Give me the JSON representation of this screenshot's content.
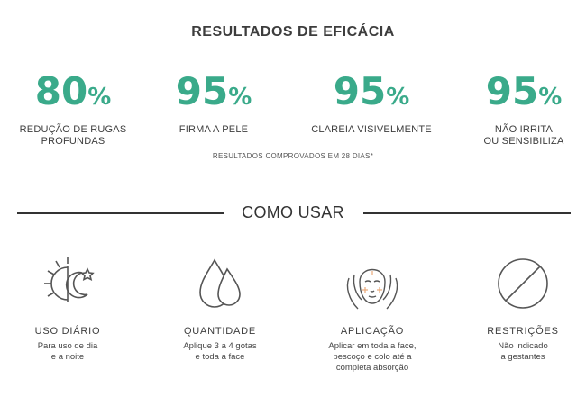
{
  "results": {
    "title": "RESULTADOS DE EFICÁCIA",
    "stats": [
      {
        "value": "80",
        "unit": "%",
        "desc1": "REDUÇÃO DE RUGAS",
        "desc2": "PROFUNDAS"
      },
      {
        "value": "95",
        "unit": "%",
        "desc1": "FIRMA A PELE",
        "desc2": ""
      },
      {
        "value": "95",
        "unit": "%",
        "desc1": "CLAREIA VISIVELMENTE",
        "desc2": ""
      },
      {
        "value": "95",
        "unit": "%",
        "desc1": "NÃO IRRITA",
        "desc2": "OU SENSIBILIZA"
      }
    ],
    "note": "RESULTADOS COMPROVADOS EM 28 DIAS*"
  },
  "usage": {
    "title": "COMO USAR",
    "items": [
      {
        "icon": "sun-moon-icon",
        "title": "USO DIÁRIO",
        "line1": "Para uso de dia",
        "line2": "e a noite",
        "line3": ""
      },
      {
        "icon": "drops-icon",
        "title": "QUANTIDADE",
        "line1": "Aplique 3 a 4 gotas",
        "line2": "e toda a face",
        "line3": ""
      },
      {
        "icon": "face-hands-icon",
        "title": "APLICAÇÃO",
        "line1": "Aplicar em toda a face,",
        "line2": "pescoço e colo até a",
        "line3": "completa absorção"
      },
      {
        "icon": "prohibited-icon",
        "title": "RESTRIÇÕES",
        "line1": "Não indicado",
        "line2": "a gestantes",
        "line3": ""
      }
    ]
  },
  "colors": {
    "accent": "#3aaa8a",
    "text": "#3d3d3d",
    "icon_stroke": "#555555",
    "icon_highlight": "#e8a878"
  }
}
